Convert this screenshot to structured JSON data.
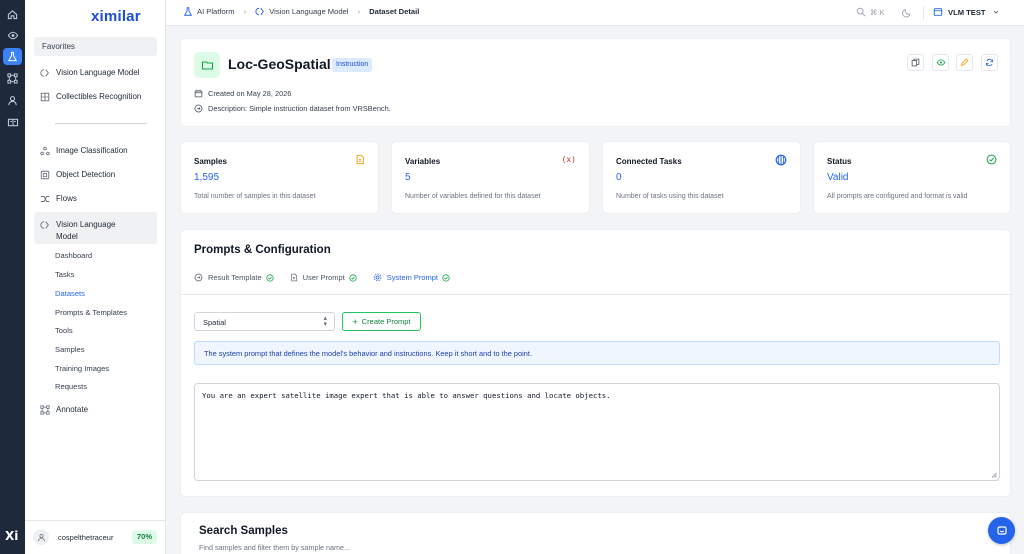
{
  "colors": {
    "accent": "#2563eb",
    "rail": "#1e2a3b",
    "success": "#16a34a",
    "warning": "#f59e0b",
    "danger": "#dc2626"
  },
  "rail": {
    "brand": "Xi",
    "icons": [
      "home-icon",
      "eye-icon",
      "flask-icon",
      "nodes-icon",
      "user-icon",
      "book-icon"
    ]
  },
  "sidebar": {
    "logo": "ximilar",
    "favorites_label": "Favorites",
    "favorites": [
      {
        "label": "Vision Language Model",
        "icon": "vlm-icon"
      },
      {
        "label": "Collectibles Recognition",
        "icon": "collectibles-icon"
      }
    ],
    "nav": [
      {
        "label": "Image Classification",
        "icon": "classification-icon"
      },
      {
        "label": "Object Detection",
        "icon": "detection-icon"
      },
      {
        "label": "Flows",
        "icon": "flows-icon"
      },
      {
        "label": "Vision Language Model",
        "icon": "vlm-icon"
      }
    ],
    "sub_items": [
      "Dashboard",
      "Tasks",
      "Datasets",
      "Prompts & Templates",
      "Tools",
      "Samples",
      "Training Images",
      "Requests"
    ],
    "active_sub": "Datasets",
    "annotate_label": "Annotate",
    "user": {
      "name": "cospelthetraceur",
      "badge": "70%"
    }
  },
  "topbar": {
    "breadcrumbs": [
      "AI Platform",
      "Vision Language Model",
      "Dataset Detail"
    ],
    "search_shortcut": "⌘ K",
    "project": "VLM TEST"
  },
  "dataset": {
    "title": "Loc-GeoSpatial",
    "badge": "Instruction",
    "created": "Created on May 28, 2026",
    "description": "Description: Simple instruction dataset from VRSBench."
  },
  "stats": [
    {
      "title": "Samples",
      "value": "1,595",
      "desc": "Total number of samples in this dataset",
      "icon": "file-icon"
    },
    {
      "title": "Variables",
      "value": "5",
      "desc": "Number of variables defined for this dataset",
      "icon": "variable-icon"
    },
    {
      "title": "Connected Tasks",
      "value": "0",
      "desc": "Number of tasks using this dataset",
      "icon": "tasks-icon"
    },
    {
      "title": "Status",
      "value": "Valid",
      "desc": "All prompts are configured and format is valid",
      "icon": "check-circle-icon"
    }
  ],
  "prompts": {
    "title": "Prompts & Configuration",
    "tabs": [
      "Result Template",
      "User Prompt",
      "System Prompt"
    ],
    "active_tab": "System Prompt",
    "select_value": "Spatial",
    "create_label": "Create Prompt",
    "info": "The system prompt that defines the model's behavior and instructions. Keep it short and to the point.",
    "prompt_text": "You are an expert satellite image expert that is able to answer questions and locate objects."
  },
  "search": {
    "title": "Search Samples",
    "subtitle": "Find samples and filter them by sample name..."
  }
}
